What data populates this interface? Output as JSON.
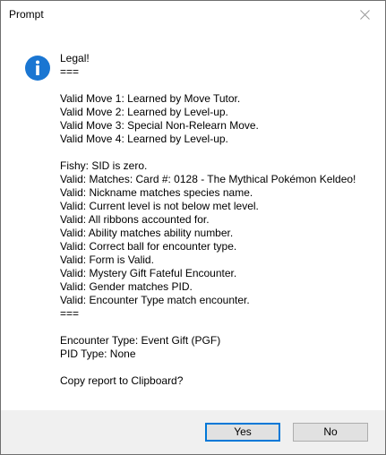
{
  "window": {
    "title": "Prompt"
  },
  "icon": {
    "name": "info-icon",
    "glyph": "i",
    "color": "#1a76d2"
  },
  "message": {
    "lines": [
      "Legal!",
      "===",
      "",
      "Valid Move 1: Learned by Move Tutor.",
      "Valid Move 2: Learned by Level-up.",
      "Valid Move 3: Special Non-Relearn Move.",
      "Valid Move 4: Learned by Level-up.",
      "",
      "Fishy: SID is zero.",
      "Valid: Matches: Card #: 0128 - The Mythical Pokémon Keldeo!",
      "Valid: Nickname matches species name.",
      "Valid: Current level is not below met level.",
      "Valid: All ribbons accounted for.",
      "Valid: Ability matches ability number.",
      "Valid: Correct ball for encounter type.",
      "Valid: Form is Valid.",
      "Valid: Mystery Gift Fateful Encounter.",
      "Valid: Gender matches PID.",
      "Valid: Encounter Type match encounter.",
      "===",
      "",
      "Encounter Type: Event Gift (PGF)",
      "PID Type: None",
      "",
      "Copy report to Clipboard?"
    ]
  },
  "buttons": {
    "yes_label": "Yes",
    "no_label": "No"
  },
  "colors": {
    "footer_bg": "#f0f0f0",
    "default_button_border": "#0078d7",
    "button_bg": "#e1e1e1"
  }
}
